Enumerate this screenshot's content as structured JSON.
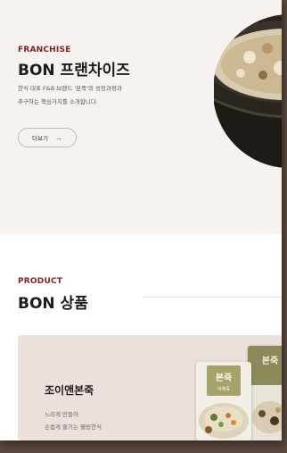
{
  "franchise": {
    "eyebrow": "FRANCHISE",
    "title": "BON 프랜차이즈",
    "desc_line1": "한식 대표 F&B 브랜드 '본죽'의 성장과정과",
    "desc_line2": "추구하는 핵심가치를 소개합니다.",
    "more_label": "더보기",
    "more_arrow": "→"
  },
  "product": {
    "eyebrow": "PRODUCT",
    "title": "BON 상품",
    "card_title": "조이앤본죽",
    "card_desc_line1": "느리게 만들어",
    "card_desc_line2": "손쉽게 즐기는 웰빙한식",
    "pack_front_brand": "본죽",
    "pack_front_flavor": "야채죽",
    "pack_back_brand": "본죽"
  },
  "colors": {
    "accent": "#7a2323",
    "pack_label_bg": "#a3a36a"
  }
}
